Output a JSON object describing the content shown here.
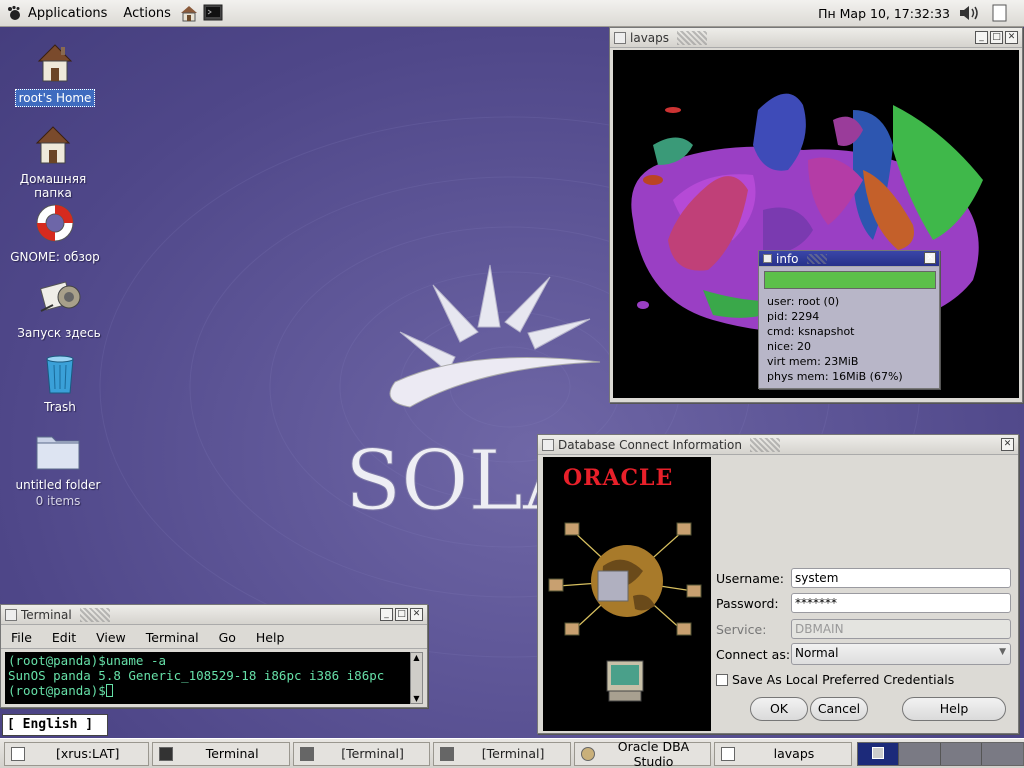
{
  "topbar": {
    "menu_applications": "Applications",
    "menu_actions": "Actions",
    "clock": "Пн Мар 10, 17:32:33"
  },
  "desktop": {
    "logo_text": "SOLA",
    "icons": [
      {
        "name": "root's Home",
        "sub": "",
        "icon": "home-icon"
      },
      {
        "name": "Домашняя папка",
        "sub": "",
        "icon": "home-icon"
      },
      {
        "name": "GNOME: обзор",
        "sub": "",
        "icon": "lifebuoy-icon"
      },
      {
        "name": "Запуск здесь",
        "sub": "",
        "icon": "launch-icon"
      },
      {
        "name": "Trash",
        "sub": "",
        "icon": "trash-icon"
      },
      {
        "name": "untitled folder",
        "sub": "0 items",
        "icon": "folder-icon"
      }
    ]
  },
  "lavaps": {
    "title": "lavaps",
    "info": {
      "title": "info",
      "lines": [
        "user: root (0)",
        "pid: 2294",
        "cmd: ksnapshot",
        "nice: 20",
        "virt mem: 23MiB",
        "phys mem: 16MiB (67%)"
      ]
    }
  },
  "oracle": {
    "title": "Database Connect Information",
    "logo": "ORACLE",
    "username_label": "Username:",
    "username_value": "system",
    "password_label": "Password:",
    "password_value": "*******",
    "service_label": "Service:",
    "service_value": "DBMAIN",
    "connect_as_label": "Connect as:",
    "connect_as_value": "Normal",
    "save_label": "Save As Local Preferred Credentials",
    "ok": "OK",
    "cancel": "Cancel",
    "help": "Help"
  },
  "terminal": {
    "title": "Terminal",
    "menu": [
      "File",
      "Edit",
      "View",
      "Terminal",
      "Go",
      "Help"
    ],
    "lines": [
      "(root@panda)$uname -a",
      "SunOS panda 5.8 Generic_108529-18 i86pc i386 i86pc",
      "(root@panda)$"
    ]
  },
  "keyboard_indicator": "[ English ]",
  "taskbar": {
    "tasks": [
      "[xrus:LAT]",
      "Terminal",
      "[Terminal]",
      "[Terminal]",
      "Oracle DBA Studio",
      "lavaps"
    ]
  },
  "colors": {
    "desktop": "#5a5190",
    "selection": "#3f6bbf",
    "terminal_bg": "#000000",
    "terminal_fg": "#66e0a8",
    "oracle_red": "#e8202a"
  }
}
